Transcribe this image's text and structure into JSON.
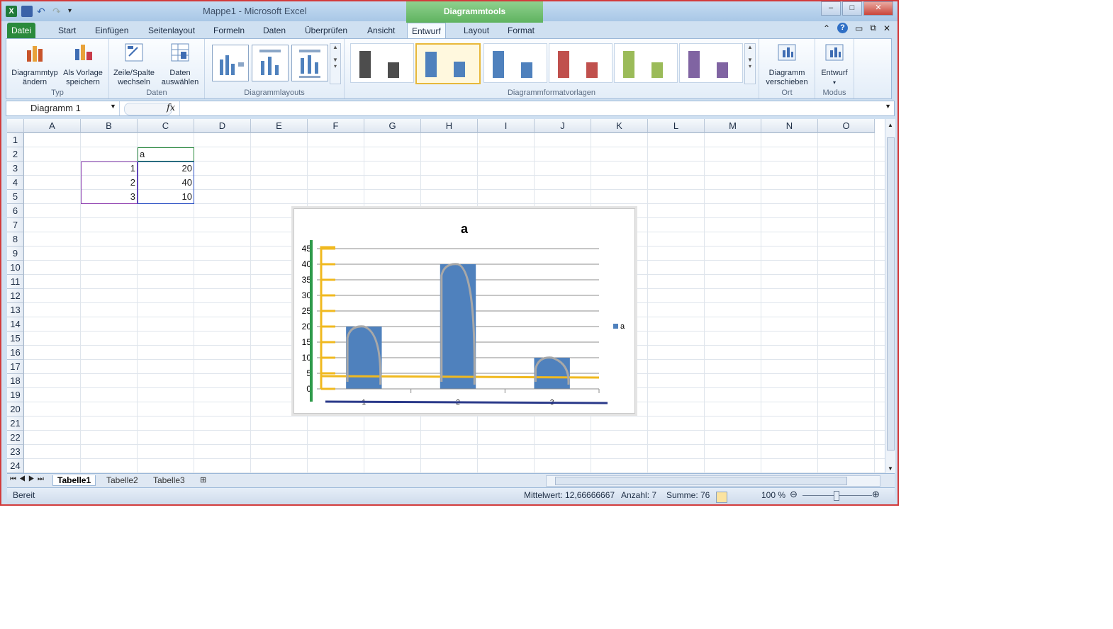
{
  "window": {
    "title": "Mappe1  -  Microsoft Excel",
    "context_tab": "Diagrammtools",
    "controls": [
      "–",
      "□",
      "✕"
    ]
  },
  "tabs": [
    "Datei",
    "Start",
    "Einfügen",
    "Seitenlayout",
    "Formeln",
    "Daten",
    "Überprüfen",
    "Ansicht",
    "Entwurf",
    "Layout",
    "Format"
  ],
  "ribbon": {
    "typ": {
      "label": "Typ",
      "btn1": "Diagrammtyp ändern",
      "btn2": "Als Vorlage speichern"
    },
    "daten": {
      "label": "Daten",
      "btn1": "Zeile/Spalte wechseln",
      "btn2": "Daten auswählen"
    },
    "layouts_label": "Diagrammlayouts",
    "styles_label": "Diagrammformatvorlagen",
    "style_colors": [
      "#4d4d4d",
      "#4f81bd",
      "#4f81bd",
      "#c0504d",
      "#9bbb59",
      "#8064a2"
    ],
    "ort": {
      "label": "Ort",
      "btn": "Diagramm verschieben"
    },
    "modus": {
      "label": "Modus",
      "btn": "Entwurf"
    }
  },
  "formula_bar": {
    "name_box": "Diagramm 1",
    "fx": "fx",
    "value": ""
  },
  "columns": [
    "A",
    "B",
    "C",
    "D",
    "E",
    "F",
    "G",
    "H",
    "I",
    "J",
    "K",
    "L",
    "M",
    "N",
    "O"
  ],
  "rows": [
    "1",
    "2",
    "3",
    "4",
    "5",
    "6",
    "7",
    "8",
    "9",
    "10",
    "11",
    "12",
    "13",
    "14",
    "15",
    "16",
    "17",
    "18",
    "19",
    "20",
    "21",
    "22",
    "23",
    "24"
  ],
  "cells": {
    "C2": "a",
    "B3": "1",
    "C3": "20",
    "B4": "2",
    "C4": "40",
    "B5": "3",
    "C5": "10"
  },
  "chart_data": {
    "type": "bar",
    "title": "a",
    "categories": [
      "1",
      "2",
      "3"
    ],
    "series": [
      {
        "name": "a",
        "values": [
          20,
          40,
          10
        ],
        "color": "#4f81bd"
      }
    ],
    "ylim": [
      0,
      45
    ],
    "yticks": [
      "0",
      "5",
      "10",
      "15",
      "20",
      "25",
      "30",
      "35",
      "40",
      "45"
    ],
    "grid": true,
    "legend": "right"
  },
  "sheets": [
    "Tabelle1",
    "Tabelle2",
    "Tabelle3"
  ],
  "status": {
    "ready": "Bereit",
    "average": "Mittelwert: 12,66666667",
    "count": "Anzahl: 7",
    "sum": "Summe: 76",
    "zoom": "100 %"
  }
}
